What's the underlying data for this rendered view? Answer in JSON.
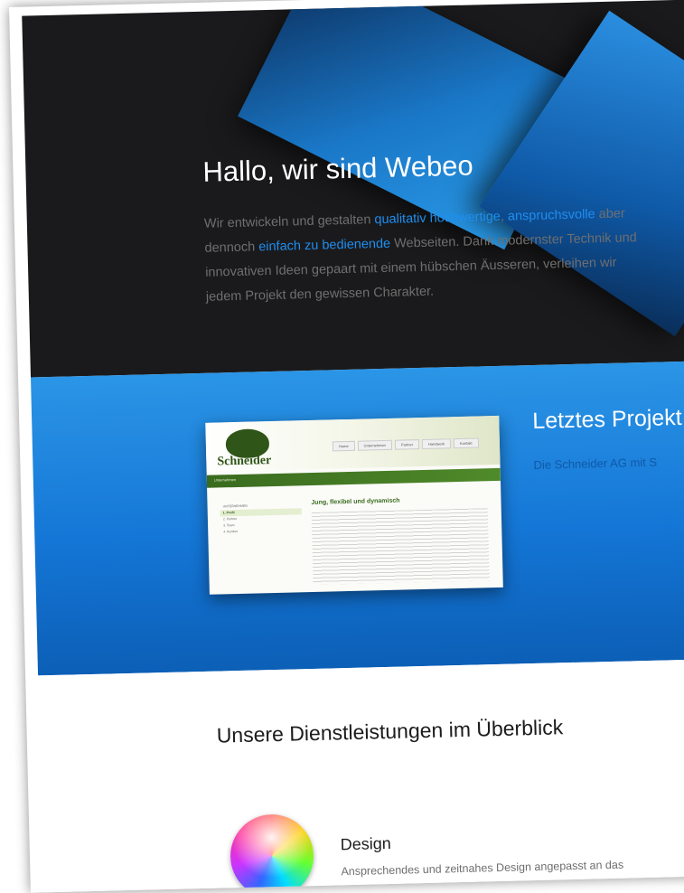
{
  "hero": {
    "title": "Hallo, wir sind Webeo",
    "text_segments": [
      "Wir entwickeln und gestalten ",
      "qualitativ hochwertige",
      ", ",
      "anspruchsvolle",
      " aber dennoch ",
      "einfach zu bedienende",
      " Webseiten. Dank modernster Technik und innovativen Ideen gepaart mit einem hübschen Äusseren, verleihen wir jedem Projekt den gewissen Charakter."
    ]
  },
  "project": {
    "title": "Letztes Projekt",
    "text": "Die Schneider AG mit S",
    "thumbnail": {
      "logo": "Schneider",
      "menu": [
        "Home",
        "Unternehmen",
        "Partner",
        "Handwerk",
        "Kontakt"
      ],
      "bar_label": "Unternehmen",
      "sidebar_heading": "UNTERNEHMEN",
      "sidebar_items": [
        "1. Profil",
        "2. Partner",
        "3. Team",
        "4. Kunden"
      ],
      "heading": "Jung, flexibel und dynamisch"
    }
  },
  "services": {
    "title": "Unsere Dienstleistungen im Überblick",
    "items": [
      {
        "title": "Design",
        "text": "Ansprechendes und zeitnahes Design angepasst an das",
        "icon": "color-wheel-icon"
      }
    ]
  },
  "colors": {
    "hero_bg": "#1a1a1c",
    "accent_blue": "#1f8ef0",
    "projects_bg": "#1476d6",
    "thumbnail_green": "#3a6b1e"
  }
}
